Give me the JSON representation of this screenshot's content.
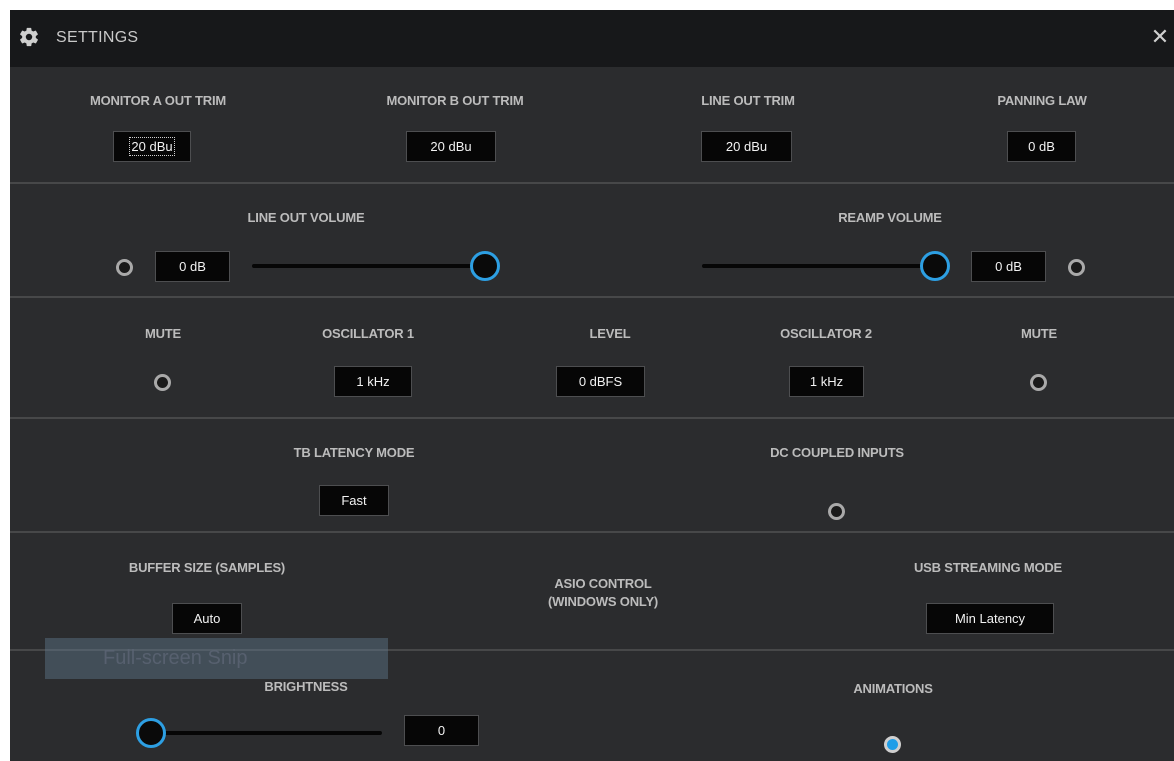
{
  "window": {
    "title": "SETTINGS",
    "close_icon": "close-icon",
    "gear_icon": "gear-icon",
    "accent_color": "#2d9fe3"
  },
  "outputs": {
    "monitor_a": {
      "label": "MONITOR A OUT TRIM",
      "value": "20 dBu"
    },
    "monitor_b": {
      "label": "MONITOR B OUT TRIM",
      "value": "20 dBu"
    },
    "line_out": {
      "label": "LINE OUT TRIM",
      "value": "20 dBu"
    },
    "panning": {
      "label": "PANNING LAW",
      "value": "0 dB"
    }
  },
  "volumes": {
    "line_out": {
      "label": "LINE OUT VOLUME",
      "value": "0 dB",
      "slider_level": 1.0
    },
    "reamp": {
      "label": "REAMP VOLUME",
      "value": "0 dB",
      "slider_level": 1.0
    }
  },
  "oscillators": {
    "mute1": {
      "label": "MUTE"
    },
    "osc1": {
      "label": "OSCILLATOR 1",
      "value": "1 kHz"
    },
    "level": {
      "label": "LEVEL",
      "value": "0 dBFS"
    },
    "osc2": {
      "label": "OSCILLATOR 2",
      "value": "1 kHz"
    },
    "mute2": {
      "label": "MUTE"
    }
  },
  "latency": {
    "tb_latency": {
      "label": "TB LATENCY MODE",
      "value": "Fast"
    },
    "dc_coupled": {
      "label": "DC COUPLED INPUTS"
    }
  },
  "buffer": {
    "buffer_size": {
      "label": "BUFFER SIZE (SAMPLES)",
      "value": "Auto"
    },
    "asio": {
      "label_line1": "ASIO CONTROL",
      "label_line2": "(WINDOWS ONLY)"
    },
    "usb_mode": {
      "label": "USB STREAMING MODE",
      "value": "Min Latency"
    }
  },
  "display": {
    "brightness": {
      "label": "BRIGHTNESS",
      "value": "0",
      "slider_level": 0.0
    },
    "animations": {
      "label": "ANIMATIONS",
      "enabled": true
    }
  },
  "overlay": {
    "snip_text": "Full-screen Snip"
  }
}
